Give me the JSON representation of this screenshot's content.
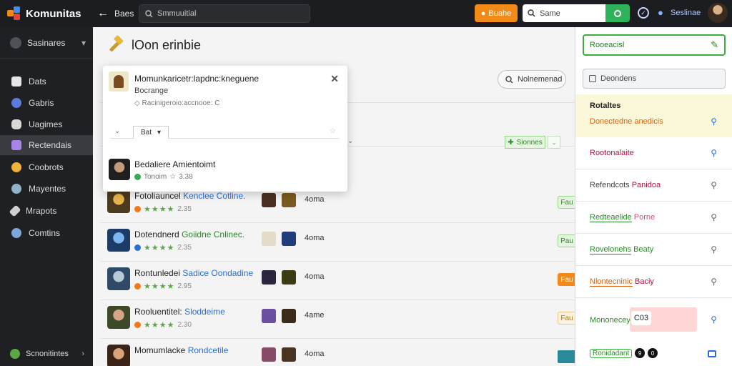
{
  "colors": {
    "accent_orange": "#f28a18",
    "accent_green": "#2fb35a",
    "link_blue": "#2a6fd6",
    "dark_bg": "#1c1d20"
  },
  "topbar": {
    "brand": "Komunitas",
    "brand_icon": "stacked-cubes-logo",
    "breadcrumb": "Baes",
    "search_placeholder": "Smmuuitial",
    "orange_button": "Buahe",
    "name_field": "Same",
    "user_name": "Seslinae"
  },
  "sidebar": {
    "account": "Sasinares",
    "items": [
      {
        "label": "Dats",
        "icon": "document-icon"
      },
      {
        "label": "Gabris",
        "icon": "globe-icon"
      },
      {
        "label": "Uagimes",
        "icon": "gamepad-icon"
      },
      {
        "label": "Rectendais",
        "icon": "grid-icon"
      },
      {
        "label": "Coobrots",
        "icon": "badge-icon"
      },
      {
        "label": "Mayentes",
        "icon": "people-icon"
      },
      {
        "label": "Mrapots",
        "icon": "edit-icon"
      },
      {
        "label": "Comtins",
        "icon": "users-icon"
      }
    ],
    "active_index": 3,
    "footer": "Scnonitintes"
  },
  "main": {
    "title": "lOon erinbie",
    "pill_button": "Nolnemenad",
    "header_tag": "Sionnes",
    "rows": [
      {
        "title_a": "Fotoliauncel",
        "title_b": "Kenclee Cotline.",
        "rating": "2.35",
        "game": "4oma",
        "tag": "Fau"
      },
      {
        "title_a": "Dotendnerd",
        "title_b": "Goiidne Cnlinec.",
        "rating": "2.35",
        "game": "4oma",
        "tag": "Pau"
      },
      {
        "title_a": "Rontunledei",
        "title_b": "Sadice Oondadine",
        "rating": "2.95",
        "game": "4oma",
        "tag": "Fau"
      },
      {
        "title_a": "Rooluentitel:",
        "title_b": "Sloddeime",
        "rating": "2.30",
        "game": "4ame",
        "tag": "Fau"
      },
      {
        "title_a": "Momumlacke",
        "title_b": "Rondcetile",
        "rating": "",
        "game": "4oma",
        "tag": ""
      }
    ]
  },
  "popup": {
    "title": "Momunkaricetr:lapdnc:kneguene",
    "subtitle": "Bocrange",
    "path": "Racinigeroio:accnooe: C",
    "tab": "Bat",
    "user_name": "Bedaliere Amientoimt",
    "user_meta": "Tonoim",
    "user_rating": "3.38"
  },
  "right_panel": {
    "input_value": "Rooeacisl",
    "search_label": "Deondens",
    "section_title": "Rotaltes",
    "items": [
      {
        "label_a": "Donectedne",
        "label_b": "anedicis",
        "color_a": "#d9630f",
        "color_b": "#d9630f"
      },
      {
        "label_a": "Rootonalaite",
        "label_b": "",
        "color_a": "#b0123e",
        "color_b": "#b0123e"
      },
      {
        "label_a": "Refendcots",
        "label_b": "Panidoa",
        "color_a": "#444444",
        "color_b": "#b0123e"
      },
      {
        "label_a": "Redteaelide",
        "label_b": "Porne",
        "color_a": "#2a8a2a",
        "color_b": "#d94b77"
      },
      {
        "label_a": "Rovelonehs",
        "label_b": "Beaty",
        "color_a": "#2a8a2a",
        "color_b": "#2a8a2a"
      },
      {
        "label_a": "Nlontecninic",
        "label_b": "Baciy",
        "color_a": "#d9630f",
        "color_b": "#b0123e"
      },
      {
        "label_a": "Mononecey",
        "label_b": "",
        "color_a": "#2a8a2a",
        "color_b": "#2a8a2a"
      }
    ],
    "badge": "C03",
    "last_label": "Ronidadant",
    "last_dots": [
      "9",
      "0"
    ]
  }
}
